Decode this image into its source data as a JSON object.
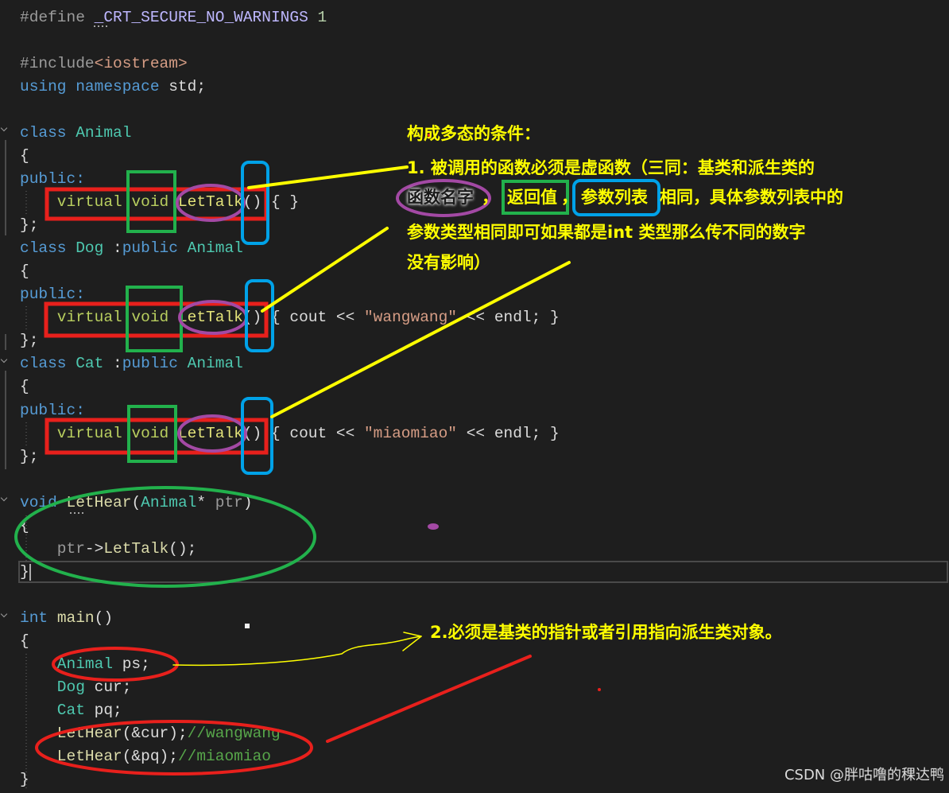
{
  "colors": {
    "background": "#1e1e1e",
    "red": "#e8201c",
    "green": "#22b14c",
    "purple": "#a349a4",
    "blue": "#00a2e8",
    "yellow": "#ffff00"
  },
  "editor": {
    "lines": [
      [
        {
          "pre": "#define "
        },
        {
          "macro": "_CRT_SECURE_NO_WARNINGS"
        },
        {
          "num": " 1"
        }
      ],
      [],
      [
        {
          "pre": "#include"
        },
        {
          "str": "<iostream>"
        }
      ],
      [
        {
          "kw": "using namespace "
        },
        {
          "plain": "std;"
        }
      ],
      [],
      [
        {
          "kw": "class "
        },
        {
          "type": "Animal"
        }
      ],
      [
        {
          "plain": "{"
        }
      ],
      [
        {
          "kw": "public:"
        }
      ],
      [
        {
          "hl": "    virtual void "
        },
        {
          "fnh": "LetTalk"
        },
        {
          "plain": "() { }"
        }
      ],
      [
        {
          "plain": "};"
        }
      ],
      [
        {
          "kw": "class "
        },
        {
          "type": "Dog "
        },
        {
          "plain": ":"
        },
        {
          "kw": "public "
        },
        {
          "type": "Animal"
        }
      ],
      [
        {
          "plain": "{"
        }
      ],
      [
        {
          "kw": "public:"
        }
      ],
      [
        {
          "hl": "    virtual void "
        },
        {
          "fnh": "LetTalk"
        },
        {
          "plain": "() { cout << "
        },
        {
          "str": "\"wangwang\""
        },
        {
          "plain": " << endl; }"
        }
      ],
      [
        {
          "plain": "};"
        }
      ],
      [
        {
          "kw": "class "
        },
        {
          "type": "Cat "
        },
        {
          "plain": ":"
        },
        {
          "kw": "public "
        },
        {
          "type": "Animal"
        }
      ],
      [
        {
          "plain": "{"
        }
      ],
      [
        {
          "kw": "public:"
        }
      ],
      [
        {
          "hl": "    virtual void "
        },
        {
          "fnh": "LetTalk"
        },
        {
          "plain": "() { cout << "
        },
        {
          "str": "\"miaomiao\""
        },
        {
          "plain": " << endl; }"
        }
      ],
      [
        {
          "plain": "};"
        }
      ],
      [],
      [
        {
          "kw": "void "
        },
        {
          "fn": "LetHear"
        },
        {
          "plain": "("
        },
        {
          "type": "Animal"
        },
        {
          "plain": "* "
        },
        {
          "param": "ptr"
        },
        {
          "plain": ")"
        }
      ],
      [
        {
          "plain": "{"
        }
      ],
      [
        {
          "param": "    ptr"
        },
        {
          "plain": "->"
        },
        {
          "fn": "LetTalk"
        },
        {
          "plain": "();"
        }
      ],
      [
        {
          "plain": "}"
        }
      ],
      [],
      [
        {
          "kw": "int "
        },
        {
          "fn": "main"
        },
        {
          "plain": "()"
        }
      ],
      [
        {
          "plain": "{"
        }
      ],
      [
        {
          "type": "    Animal "
        },
        {
          "plain": "ps;"
        }
      ],
      [
        {
          "type": "    Dog "
        },
        {
          "plain": "cur;"
        }
      ],
      [
        {
          "type": "    Cat "
        },
        {
          "plain": "pq;"
        }
      ],
      [
        {
          "fn": "    LetHear"
        },
        {
          "plain": "(&cur);"
        },
        {
          "comment": "//wangwang"
        }
      ],
      [
        {
          "fn": "    LetHear"
        },
        {
          "plain": "(&pq);"
        },
        {
          "comment": "//miaomiao"
        }
      ],
      [
        {
          "plain": "}"
        }
      ]
    ]
  },
  "annotations": {
    "heading": "构成多态的条件：",
    "rule1": {
      "line1": "1. 被调用的函数必须是虚函数（三同：基类和派生类的",
      "line2": [
        "函数名字",
        "，",
        "返回值",
        "，",
        "参数列表",
        "相同，具体参数列表中的"
      ],
      "line3": "参数类型相同即可如果都是int 类型那么传不同的数字",
      "line4": "没有影响）"
    },
    "rule2": "2.必须是基类的指针或者引用指向派生类对象。"
  },
  "watermark": "CSDN @胖咕噜的稞达鸭"
}
